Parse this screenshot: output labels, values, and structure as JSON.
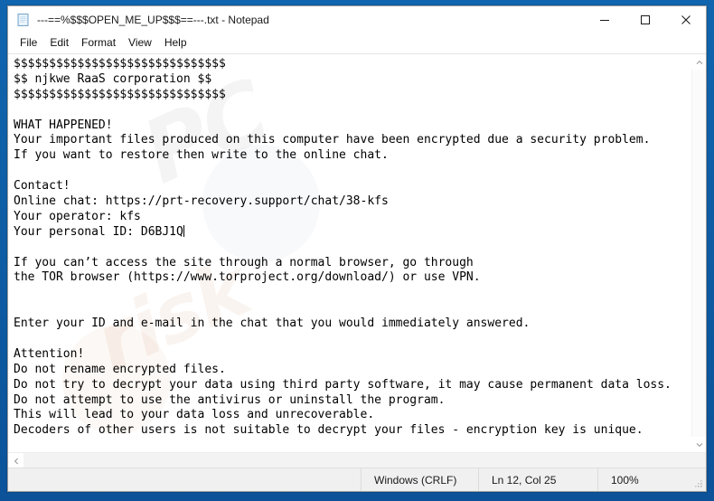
{
  "window": {
    "title": "---==%$$$OPEN_ME_UP$$$==---.txt - Notepad",
    "icon": "notepad-icon",
    "controls": {
      "minimize": "–",
      "maximize": "□",
      "close": "✕"
    }
  },
  "menubar": {
    "items": [
      {
        "label": "File"
      },
      {
        "label": "Edit"
      },
      {
        "label": "Format"
      },
      {
        "label": "View"
      },
      {
        "label": "Help"
      }
    ]
  },
  "document": {
    "lines": [
      "$$$$$$$$$$$$$$$$$$$$$$$$$$$$$$",
      "$$ njkwe RaaS corporation $$",
      "$$$$$$$$$$$$$$$$$$$$$$$$$$$$$$",
      "",
      "WHAT HAPPENED!",
      "Your important files produced on this computer have been encrypted due a security problem.",
      "If you want to restore then write to the online chat.",
      "",
      "Contact!",
      "Online chat: https://prt-recovery.support/chat/38-kfs",
      "Your operator: kfs",
      "Your personal ID: D6BJ1Q",
      "",
      "If you can’t access the site through a normal browser, go through",
      "the TOR browser (https://www.torproject.org/download/) or use VPN.",
      "",
      "",
      "Enter your ID and e-mail in the chat that you would immediately answered.",
      "",
      "Attention!",
      "Do not rename encrypted files.",
      "Do not try to decrypt your data using third party software, it may cause permanent data loss.",
      "Do not attempt to use the antivirus or uninstall the program.",
      "This will lead to your data loss and unrecoverable.",
      "Decoders of other users is not suitable to decrypt your files - encryption key is unique."
    ],
    "caret_line_index": 11
  },
  "scrollbars": {
    "vertical": {
      "up_arrow": "⌃",
      "down_arrow": "⌄"
    },
    "horizontal": {
      "left_arrow": "‹",
      "right_arrow": "›"
    }
  },
  "statusbar": {
    "line_ending": "Windows (CRLF)",
    "cursor_position": "Ln 12, Col 25",
    "zoom": "100%"
  },
  "watermark": {
    "text_top": "PC",
    "text_bottom": "risk"
  },
  "colors": {
    "desktop": "#0f5fa6",
    "window_bg": "#ffffff",
    "text": "#000000",
    "statusbar_bg": "#f0f0f0",
    "border": "#9b9b9b"
  }
}
